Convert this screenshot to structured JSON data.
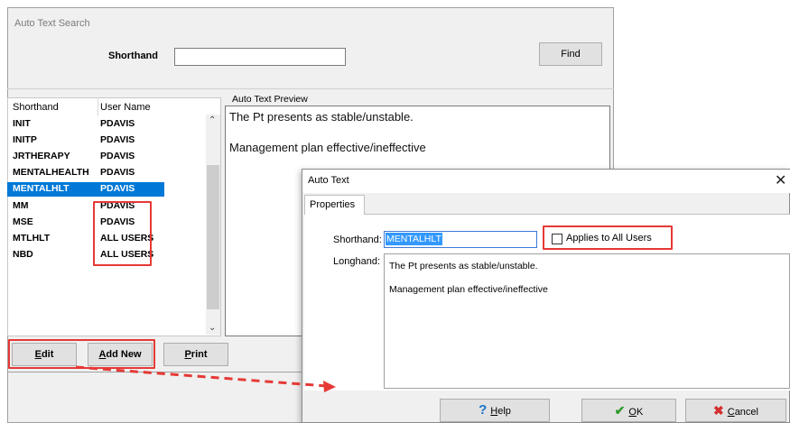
{
  "main_window": {
    "title": "Auto Text Search",
    "shorthand_label": "Shorthand",
    "shorthand_value": "",
    "find_label": "Find",
    "list": {
      "columns": [
        "Shorthand",
        "User Name"
      ],
      "rows": [
        {
          "shorthand": "INIT",
          "user": "PDAVIS"
        },
        {
          "shorthand": "INITP",
          "user": "PDAVIS"
        },
        {
          "shorthand": "JRTHERAPY",
          "user": "PDAVIS"
        },
        {
          "shorthand": "MENTALHEALTH",
          "user": "PDAVIS"
        },
        {
          "shorthand": "MENTALHLT",
          "user": "PDAVIS",
          "selected": true
        },
        {
          "shorthand": "MM",
          "user": "PDAVIS"
        },
        {
          "shorthand": "MSE",
          "user": "PDAVIS"
        },
        {
          "shorthand": "MTLHLT",
          "user": "ALL USERS"
        },
        {
          "shorthand": "NBD",
          "user": "ALL USERS"
        }
      ]
    },
    "preview": {
      "title": "Auto Text Preview",
      "line1": "The Pt presents as stable/unstable.",
      "line2": "Management plan effective/ineffective"
    },
    "buttons": {
      "edit_mnemonic": "E",
      "edit_rest": "dit",
      "addnew_mnemonic": "A",
      "addnew_rest": "dd New",
      "print_mnemonic": "P",
      "print_rest": "rint"
    }
  },
  "dialog": {
    "title": "Auto Text",
    "close_icon": "close-icon",
    "tab": "Properties",
    "shorthand_label": "Shorthand:",
    "shorthand_value": "MENTALHLT",
    "applies_label": "Applies to All Users",
    "applies_checked": false,
    "longhand_label": "Longhand:",
    "longhand_line1": "The Pt presents as stable/unstable.",
    "longhand_line2": "Management plan effective/ineffective",
    "help_mnemonic": "H",
    "help_rest": "elp",
    "ok_mnemonic": "O",
    "ok_rest": "K",
    "cancel_mnemonic": "C",
    "cancel_rest": "ancel"
  },
  "colors": {
    "selection": "#0078d7",
    "highlight": "#e53935",
    "ok_check": "#2e9b2e"
  }
}
